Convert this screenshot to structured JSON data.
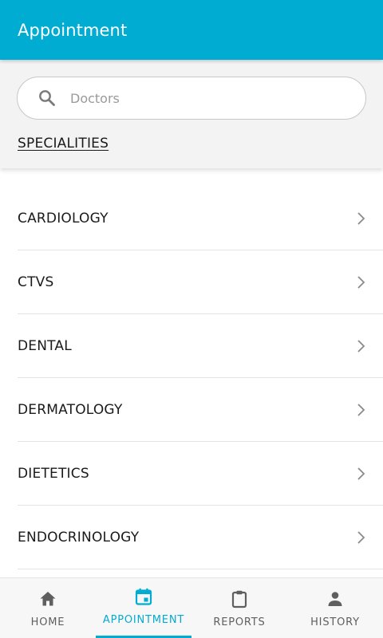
{
  "app_bar": {
    "title": "Appointment"
  },
  "search": {
    "placeholder": "Doctors",
    "icon": "search-icon"
  },
  "specialities_link": "SPECIALITIES",
  "specialities": [
    {
      "label": "CARDIOLOGY"
    },
    {
      "label": "CTVS"
    },
    {
      "label": "DENTAL"
    },
    {
      "label": "DERMATOLOGY"
    },
    {
      "label": "DIETETICS"
    },
    {
      "label": "ENDOCRINOLOGY"
    }
  ],
  "bottom_nav": [
    {
      "label": "HOME",
      "icon": "home-icon",
      "active": false
    },
    {
      "label": "APPOINTMENT",
      "icon": "calendar-icon",
      "active": true
    },
    {
      "label": "REPORTS",
      "icon": "clipboard-icon",
      "active": false
    },
    {
      "label": "HISTORY",
      "icon": "person-icon",
      "active": false
    }
  ],
  "colors": {
    "primary": "#00acd1",
    "nav_inactive": "#5f5f5f",
    "search_panel_bg": "#f3f3f3"
  }
}
